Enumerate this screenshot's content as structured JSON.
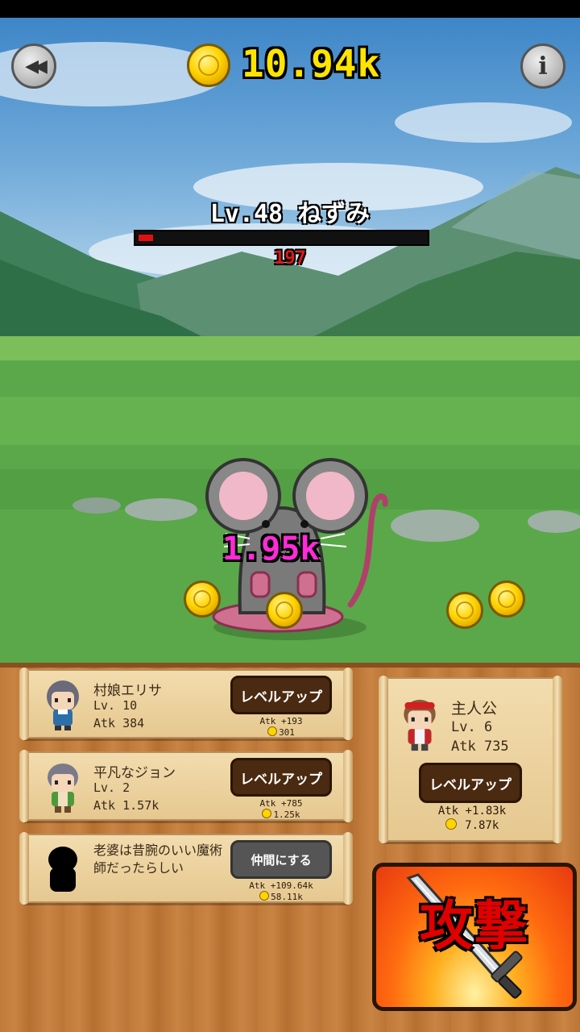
{
  "header": {
    "back_icon": "rewind-icon",
    "info_icon": "info-icon",
    "info_label": "i",
    "gold": "10.94k"
  },
  "enemy": {
    "name": "Lv.48 ねずみ",
    "hp_text": "197",
    "hp_fraction": 0.05,
    "damage": "1.95k"
  },
  "allies": [
    {
      "name": "村娘エリサ",
      "level": "Lv. 10",
      "atk": "Atk 384",
      "button": "レベルアップ",
      "up_atk": "Atk +193",
      "cost": "301"
    },
    {
      "name": "平凡なジョン",
      "level": "Lv. 2",
      "atk": "Atk 1.57k",
      "button": "レベルアップ",
      "up_atk": "Atk +785",
      "cost": "1.25k"
    },
    {
      "name": "老婆は昔腕のいい魔術師だったらしい",
      "level": "",
      "atk": "",
      "button": "仲間にする",
      "up_atk": "Atk +109.64k",
      "cost": "58.11k"
    }
  ],
  "hero": {
    "name": "主人公",
    "level": "Lv. 6",
    "atk": "Atk 735",
    "button": "レベルアップ",
    "up_atk": "Atk +1.83k",
    "cost": "7.87k"
  },
  "attack": {
    "label": "攻撃"
  },
  "colors": {
    "gold": "#ffe400",
    "damage": "#ff2ad8",
    "hp": "#e01010",
    "attack_text": "#e00000"
  }
}
